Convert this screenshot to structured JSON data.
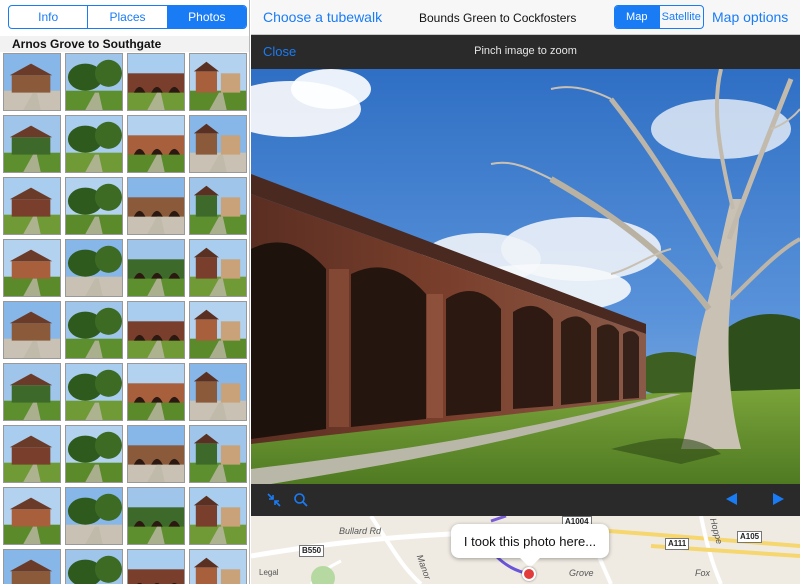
{
  "left_tabs": [
    {
      "label": "Info",
      "active": false
    },
    {
      "label": "Places",
      "active": false
    },
    {
      "label": "Photos",
      "active": true
    }
  ],
  "section_title": "Arnos Grove to Southgate",
  "header": {
    "choose_label": "Choose a tubewalk",
    "route_title": "Bounds Green to Cockfosters",
    "map_type_tabs": [
      {
        "label": "Map",
        "active": true
      },
      {
        "label": "Satellite",
        "active": false
      }
    ],
    "map_options_label": "Map options"
  },
  "viewer": {
    "close_label": "Close",
    "zoom_hint": "Pinch image to zoom",
    "footer_icons": [
      "shrink-icon",
      "search-icon",
      "prev-arrow-icon",
      "next-arrow-icon"
    ]
  },
  "map": {
    "callout_text": "I took this photo here...",
    "legal_label": "Legal",
    "road_labels": [
      "Bullard Rd",
      "Manor",
      "Grove",
      "Hoppe",
      "Fox"
    ],
    "shields": [
      "B550",
      "A1004",
      "A111",
      "A105"
    ]
  },
  "colors": {
    "accent": "#1a7cf5",
    "viewer_bar": "#2a2a2a",
    "pin": "#e23b3b"
  },
  "thumbnails_visible": 36
}
